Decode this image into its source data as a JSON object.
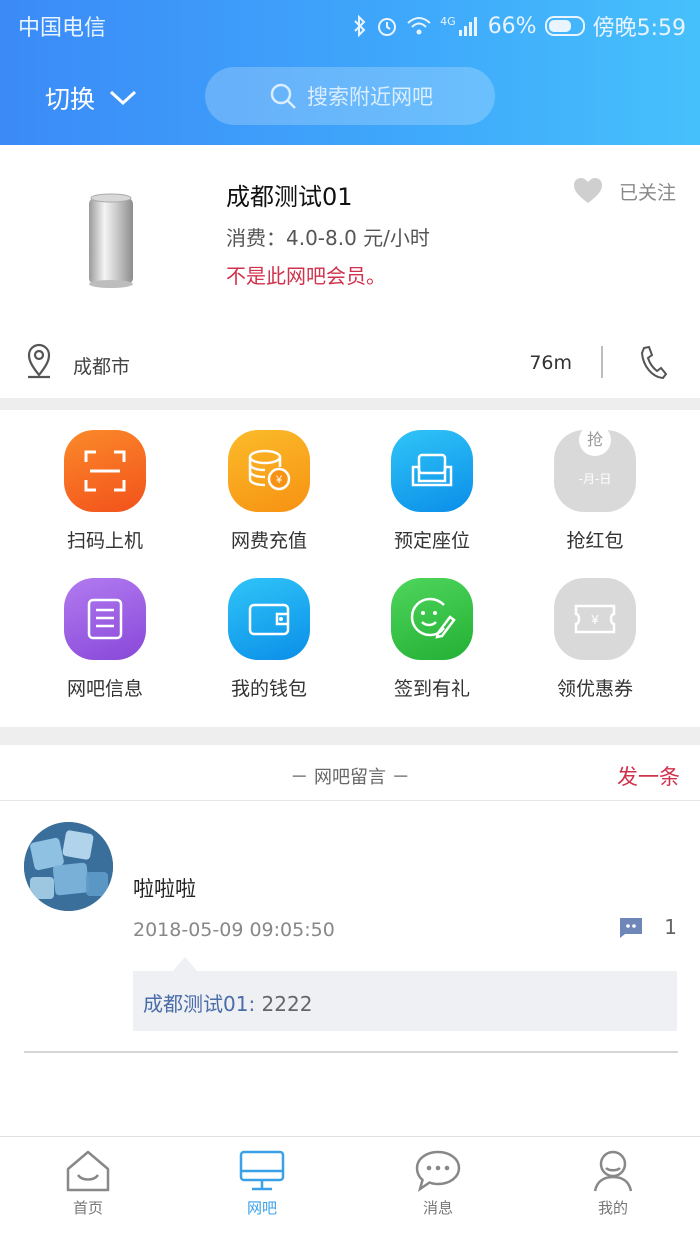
{
  "status_bar": {
    "carrier": "中国电信",
    "network": "4G",
    "battery": "66%",
    "time": "傍晚5:59"
  },
  "header": {
    "switch_label": "切换",
    "search_placeholder": "搜索附近网吧"
  },
  "cafe": {
    "name": "成都测试01",
    "price": "消费：4.0-8.0 元/小时",
    "member_status": "不是此网吧会员。",
    "follow_label": "已关注",
    "city": "成都市",
    "distance": "76m"
  },
  "features": [
    {
      "label": "扫码上机",
      "icon": "scan-icon",
      "color": "#f7651e"
    },
    {
      "label": "网费充值",
      "icon": "coin-stack-icon",
      "color": "#f8a21c"
    },
    {
      "label": "预定座位",
      "icon": "sofa-icon",
      "color": "#14a8f0"
    },
    {
      "label": "抢红包",
      "icon": "red-packet-icon",
      "color": "#d7d7d7",
      "badge": "抢",
      "subtext": "-月-日"
    },
    {
      "label": "网吧信息",
      "icon": "document-icon",
      "color": "#9b5ee3"
    },
    {
      "label": "我的钱包",
      "icon": "wallet-icon",
      "color": "#14a8f0"
    },
    {
      "label": "签到有礼",
      "icon": "smile-sign-icon",
      "color": "#35c045"
    },
    {
      "label": "领优惠券",
      "icon": "coupon-icon",
      "color": "#d7d7d7"
    }
  ],
  "messages_section": {
    "title": "－ 网吧留言 －",
    "post_button": "发一条",
    "items": [
      {
        "text": "啦啦啦",
        "time": "2018-05-09 09:05:50",
        "comment_count": "1",
        "reply_author": "成都测试01:",
        "reply_text": " 2222"
      }
    ]
  },
  "tabbar": {
    "tabs": [
      {
        "label": "首页",
        "icon": "home-icon"
      },
      {
        "label": "网吧",
        "icon": "monitor-icon",
        "active": true
      },
      {
        "label": "消息",
        "icon": "chat-icon"
      },
      {
        "label": "我的",
        "icon": "user-icon"
      }
    ],
    "active_color": "#3aa0e8"
  }
}
